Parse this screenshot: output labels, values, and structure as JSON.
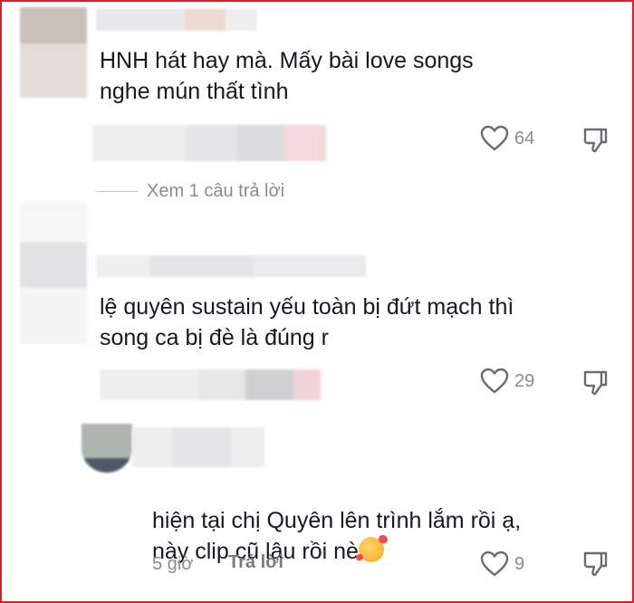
{
  "comments": [
    {
      "text": "HNH hát hay mà. Mấy bài love songs\nnghe mún thất tình",
      "likes": "64",
      "view_replies": "Xem 1 câu trả lời"
    },
    {
      "text": "lệ quyên sustain yếu toàn bị đứt mạch thì\nsong ca bị đè là đúng r",
      "likes": "29"
    }
  ],
  "reply": {
    "text": "hiện tại chị Quyên lên trình lắm rồi ạ,\nnày clip cũ lâu rồi nè",
    "emoji": "smiling-face-with-hearts",
    "time": "5 giờ",
    "reply_label": "Trả lời",
    "likes": "9"
  },
  "colors": {
    "frame_border": "#d8202a",
    "text": "#161823",
    "muted": "#8a8b91"
  }
}
